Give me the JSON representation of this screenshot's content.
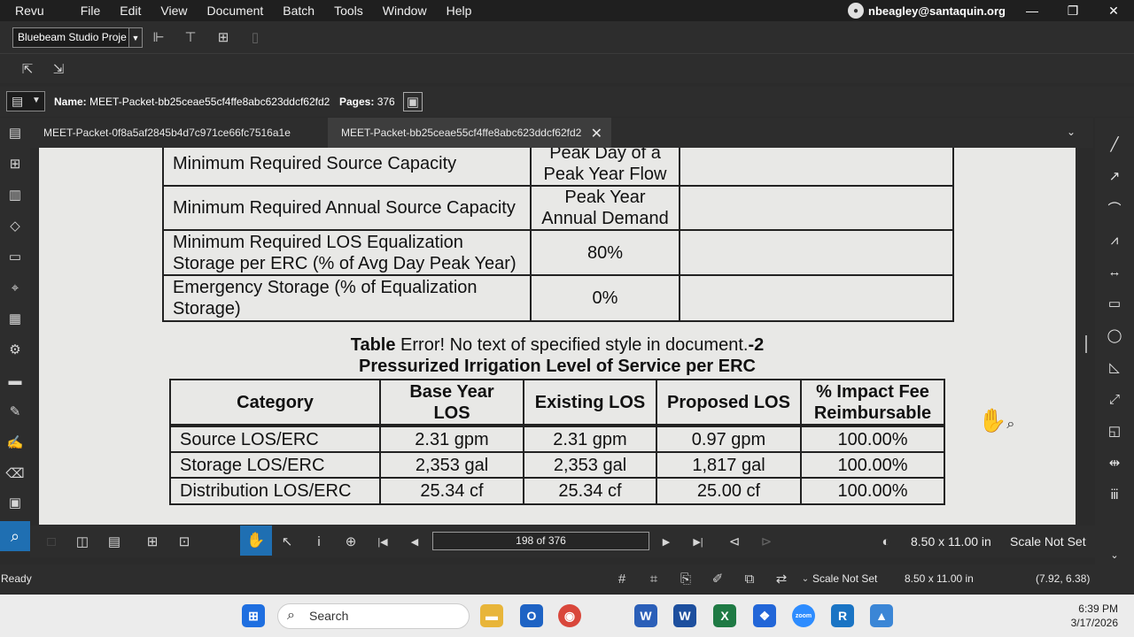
{
  "menu": [
    "Revu",
    "File",
    "Edit",
    "View",
    "Document",
    "Batch",
    "Tools",
    "Window",
    "Help"
  ],
  "user": {
    "email": "nbeagley@santaquin.org"
  },
  "toolbar": {
    "studio_project": "Bluebeam Studio Proje"
  },
  "docinfo": {
    "name_label": "Name:",
    "name_value": "MEET-Packet-bb25ceae55cf4ffe8abc623ddcf62fd2",
    "pages_label": "Pages:",
    "pages_value": "376"
  },
  "tabs": [
    {
      "label": "MEET-Packet-0f8a5af2845b4d7c971ce66fc7516a1e",
      "active": false
    },
    {
      "label": "MEET-Packet-bb25ceae55cf4ffe8abc623ddcf62fd2",
      "active": true
    }
  ],
  "document": {
    "table1": {
      "rows": [
        [
          "Minimum Required Source Capacity",
          "Peak Day of a\nPeak Year Flow",
          ""
        ],
        [
          "Minimum Required Annual Source Capacity",
          "Peak Year\nAnnual Demand",
          ""
        ],
        [
          "Minimum Required LOS Equalization\nStorage per ERC (% of Avg Day Peak Year)",
          "80%",
          ""
        ],
        [
          "Emergency Storage (% of Equalization\nStorage)",
          "0%",
          ""
        ]
      ]
    },
    "caption_prefix": "Table",
    "caption_error": " Error! No text of specified style in document.",
    "caption_suffix": "-2",
    "caption_title": "Pressurized Irrigation Level of Service per ERC",
    "table2": {
      "headers": [
        "Category",
        "Base Year\nLOS",
        "Existing LOS",
        "Proposed LOS",
        "% Impact Fee\nReimbursable"
      ],
      "rows": [
        [
          "Source LOS/ERC",
          "2.31 gpm",
          "2.31 gpm",
          "0.97 gpm",
          "100.00%"
        ],
        [
          "Storage LOS/ERC",
          "2,353 gal",
          "2,353 gal",
          "1,817 gal",
          "100.00%"
        ],
        [
          "Distribution LOS/ERC",
          "25.34 cf",
          "25.34 cf",
          "25.00 cf",
          "100.00%"
        ]
      ]
    }
  },
  "nav": {
    "page_indicator": "198 of 376",
    "page_size": "8.50 x 11.00 in",
    "scale": "Scale Not Set"
  },
  "status": {
    "ready": "Ready",
    "scale": "Scale Not Set",
    "size": "8.50 x 11.00 in",
    "coords": "(7.92, 6.38)"
  },
  "taskbar": {
    "search_placeholder": "Search",
    "time": "6:39 PM",
    "date": "3/17/2026"
  }
}
